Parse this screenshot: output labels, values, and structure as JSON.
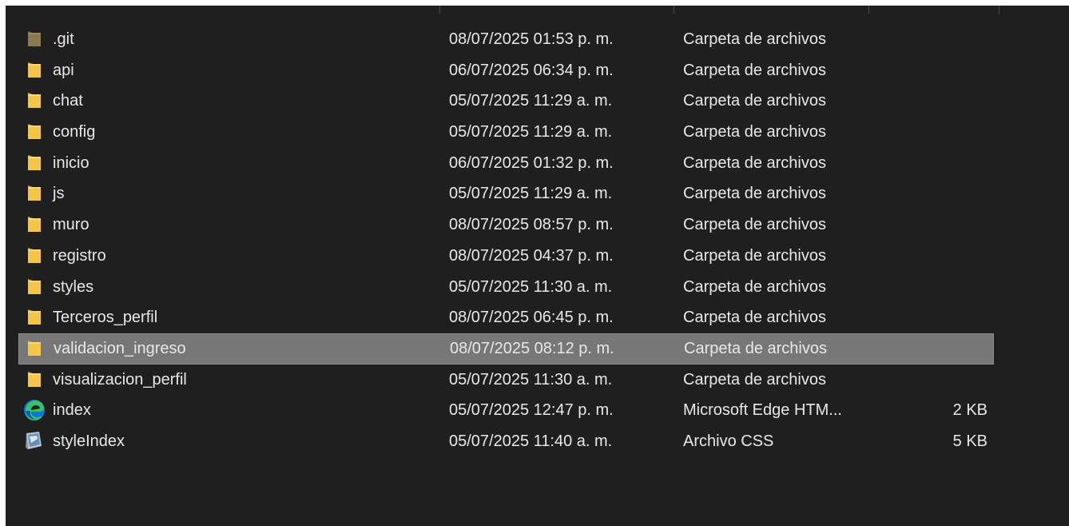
{
  "accent": {
    "background": "#1f1f1f",
    "selected_row": "#777777",
    "text": "#e8e8e8",
    "folder": "#f3c64a",
    "git_folder": "#8a7a52"
  },
  "files": [
    {
      "name": ".git",
      "date": "08/07/2025 01:53 p. m.",
      "type": "Carpeta de archivos",
      "size": "",
      "icon": "folder-icon"
    },
    {
      "name": "api",
      "date": "06/07/2025 06:34 p. m.",
      "type": "Carpeta de archivos",
      "size": "",
      "icon": "folder-icon"
    },
    {
      "name": "chat",
      "date": "05/07/2025 11:29 a. m.",
      "type": "Carpeta de archivos",
      "size": "",
      "icon": "folder-icon"
    },
    {
      "name": "config",
      "date": "05/07/2025 11:29 a. m.",
      "type": "Carpeta de archivos",
      "size": "",
      "icon": "folder-icon"
    },
    {
      "name": "inicio",
      "date": "06/07/2025 01:32 p. m.",
      "type": "Carpeta de archivos",
      "size": "",
      "icon": "folder-icon"
    },
    {
      "name": "js",
      "date": "05/07/2025 11:29 a. m.",
      "type": "Carpeta de archivos",
      "size": "",
      "icon": "folder-icon"
    },
    {
      "name": "muro",
      "date": "08/07/2025 08:57 p. m.",
      "type": "Carpeta de archivos",
      "size": "",
      "icon": "folder-icon"
    },
    {
      "name": "registro",
      "date": "08/07/2025 04:37 p. m.",
      "type": "Carpeta de archivos",
      "size": "",
      "icon": "folder-icon"
    },
    {
      "name": "styles",
      "date": "05/07/2025 11:30 a. m.",
      "type": "Carpeta de archivos",
      "size": "",
      "icon": "folder-icon"
    },
    {
      "name": "Terceros_perfil",
      "date": "08/07/2025 06:45 p. m.",
      "type": "Carpeta de archivos",
      "size": "",
      "icon": "folder-icon"
    },
    {
      "name": "validacion_ingreso",
      "date": "08/07/2025 08:12 p. m.",
      "type": "Carpeta de archivos",
      "size": "",
      "icon": "folder-icon",
      "selected": true
    },
    {
      "name": "visualizacion_perfil",
      "date": "05/07/2025 11:30 a. m.",
      "type": "Carpeta de archivos",
      "size": "",
      "icon": "folder-icon"
    },
    {
      "name": "index",
      "date": "05/07/2025 12:47 p. m.",
      "type": "Microsoft Edge HTM...",
      "size": "2 KB",
      "icon": "edge-icon"
    },
    {
      "name": "styleIndex",
      "date": "05/07/2025 11:40 a. m.",
      "type": "Archivo CSS",
      "size": "5 KB",
      "icon": "css-file-icon"
    }
  ]
}
